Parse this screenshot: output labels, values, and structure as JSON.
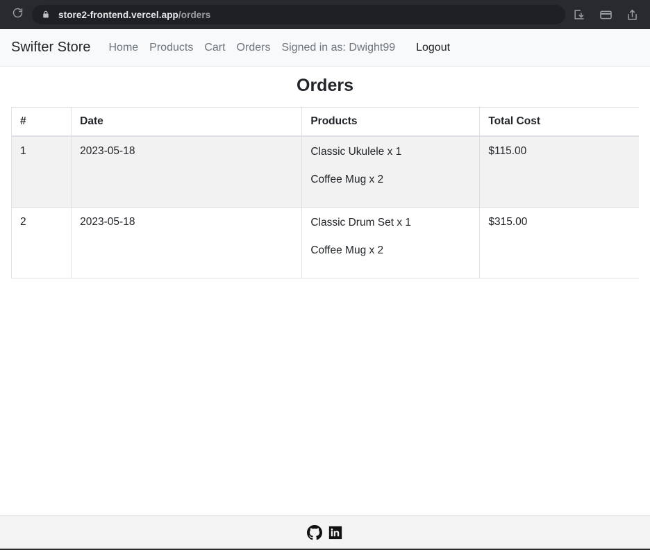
{
  "browser": {
    "reload_icon": "reload-icon",
    "lock_icon": "lock-icon",
    "url_domain": "store2-frontend.vercel.app",
    "url_path": "/orders",
    "actions": [
      {
        "name": "download-icon",
        "label": "Downloads"
      },
      {
        "name": "wallet-icon",
        "label": "Payment methods"
      },
      {
        "name": "share-icon",
        "label": "Share"
      }
    ]
  },
  "nav": {
    "brand": "Swifter Store",
    "links": [
      {
        "label": "Home"
      },
      {
        "label": "Products"
      },
      {
        "label": "Cart"
      },
      {
        "label": "Orders"
      }
    ],
    "signed_in_text": "Signed in as: Dwight99",
    "logout_label": "Logout"
  },
  "main": {
    "title": "Orders",
    "table": {
      "headers": [
        "#",
        "Date",
        "Products",
        "Total Cost"
      ],
      "rows": [
        {
          "num": "1",
          "date": "2023-05-18",
          "products": [
            "Classic Ukulele x 1",
            "Coffee Mug x 2"
          ],
          "total": "$115.00"
        },
        {
          "num": "2",
          "date": "2023-05-18",
          "products": [
            "Classic Drum Set x 1",
            "Coffee Mug x 2"
          ],
          "total": "$315.00"
        }
      ]
    }
  },
  "footer": {
    "social": [
      {
        "name": "github-icon",
        "label": "GitHub"
      },
      {
        "name": "linkedin-icon",
        "label": "LinkedIn"
      }
    ]
  },
  "colors": {
    "chrome_bg": "#282a2d",
    "url_pill_bg": "#1f2023",
    "nav_bg": "#f8f9fa",
    "nav_link": "#6c757d",
    "text": "#212529",
    "row_stripe": "#f2f2f2",
    "table_border": "#dee2e6",
    "footer_bg": "#f4f4f4"
  }
}
